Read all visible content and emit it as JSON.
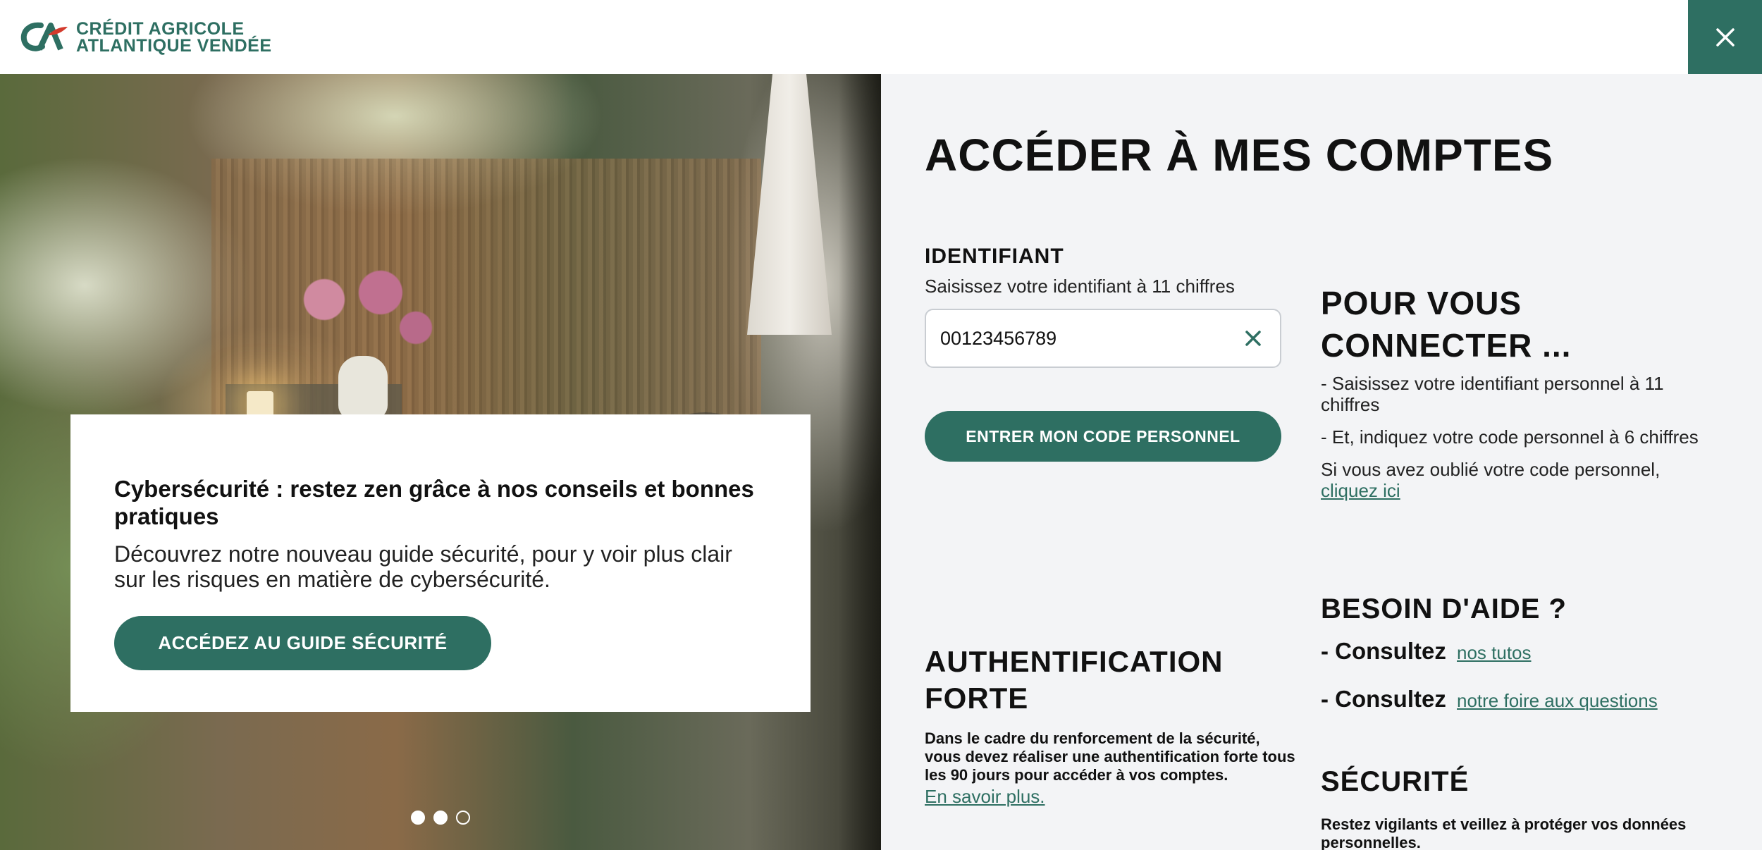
{
  "brand": {
    "line1": "CRÉDIT AGRICOLE",
    "line2": "ATLANTIQUE VENDÉE",
    "primary_color": "#2e6f62",
    "accent_color": "#d33a2c"
  },
  "header": {
    "close_icon": "close-icon"
  },
  "hero": {
    "promo_title": "Cybersécurité : restez zen grâce à nos conseils et bonnes pratiques",
    "promo_text": "Découvrez notre nouveau guide sécurité, pour y voir plus clair sur les risques en matière de cybersécurité.",
    "promo_button": "ACCÉDEZ AU GUIDE SÉCURITÉ",
    "carousel": {
      "total": 3,
      "active_indexes": [
        0,
        1
      ]
    }
  },
  "login": {
    "title": "ACCÉDER À MES COMPTES",
    "id_label": "IDENTIFIANT",
    "id_help": "Saisissez votre identifiant à 11 chiffres",
    "id_value": "00123456789",
    "enter_button": "ENTRER MON CODE PERSONNEL"
  },
  "auth": {
    "title": "AUTHENTIFICATION FORTE",
    "text": "Dans le cadre du renforcement de la sécurité, vous devez réaliser une authentification forte tous les 90 jours pour accéder à vos comptes.",
    "link": "En savoir plus."
  },
  "connect": {
    "title": "POUR VOUS CONNECTER ...",
    "step1": "- Saisissez votre identifiant personnel à 11 chiffres",
    "step2": "- Et, indiquez votre code personnel à 6 chiffres",
    "forgot_text": "Si vous avez oublié votre code personnel,",
    "forgot_link": "cliquez ici"
  },
  "help": {
    "title": "BESOIN D'AIDE ?",
    "consult_label": "- Consultez",
    "tutos_link": "nos tutos",
    "faq_link": "notre foire aux questions"
  },
  "security": {
    "title": "SÉCURITÉ",
    "text": "Restez vigilants et veillez à protéger vos données personnelles."
  }
}
